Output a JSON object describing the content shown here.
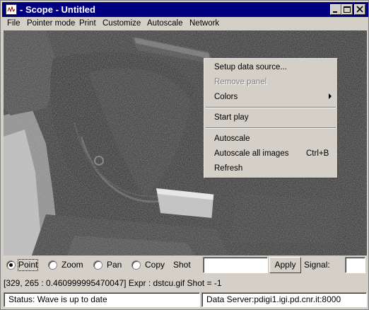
{
  "window": {
    "title": "- Scope - Untitled",
    "app_icon": "scope-app-icon",
    "controls": [
      "minimize-icon",
      "maximize-icon",
      "close-icon"
    ]
  },
  "menubar": {
    "items": [
      "File",
      "Pointer mode",
      "Print",
      "Customize",
      "Autoscale",
      "Network"
    ]
  },
  "context_menu": {
    "items": [
      {
        "label": "Setup data source...",
        "enabled": true
      },
      {
        "label": "Remove panel",
        "enabled": false
      },
      {
        "label": "Colors",
        "enabled": true,
        "submenu": true
      },
      {
        "label": "Start play",
        "enabled": true
      },
      {
        "label": "Autoscale",
        "enabled": true
      },
      {
        "label": "Autoscale all images",
        "enabled": true,
        "shortcut": "Ctrl+B"
      },
      {
        "label": "Refresh",
        "enabled": true
      }
    ]
  },
  "toolbar": {
    "modes": [
      {
        "label": "Point",
        "selected": true
      },
      {
        "label": "Zoom",
        "selected": false
      },
      {
        "label": "Pan",
        "selected": false
      },
      {
        "label": "Copy",
        "selected": false
      }
    ],
    "shot_label": "Shot",
    "shot_value": "",
    "apply_label": "Apply",
    "signal_label": "Signal:",
    "signal_value": ""
  },
  "pointer_info": "[329, 265 : 0.460999995470047] Expr : dstcu.gif Shot = -1",
  "status": {
    "left": "Status: Wave is up to date",
    "right": "Data Server:pdigi1.igi.pd.cnr.it:8000"
  },
  "colors": {
    "titlebar": "#000080",
    "face": "#d4d0c8",
    "disabled_text": "#808080"
  }
}
